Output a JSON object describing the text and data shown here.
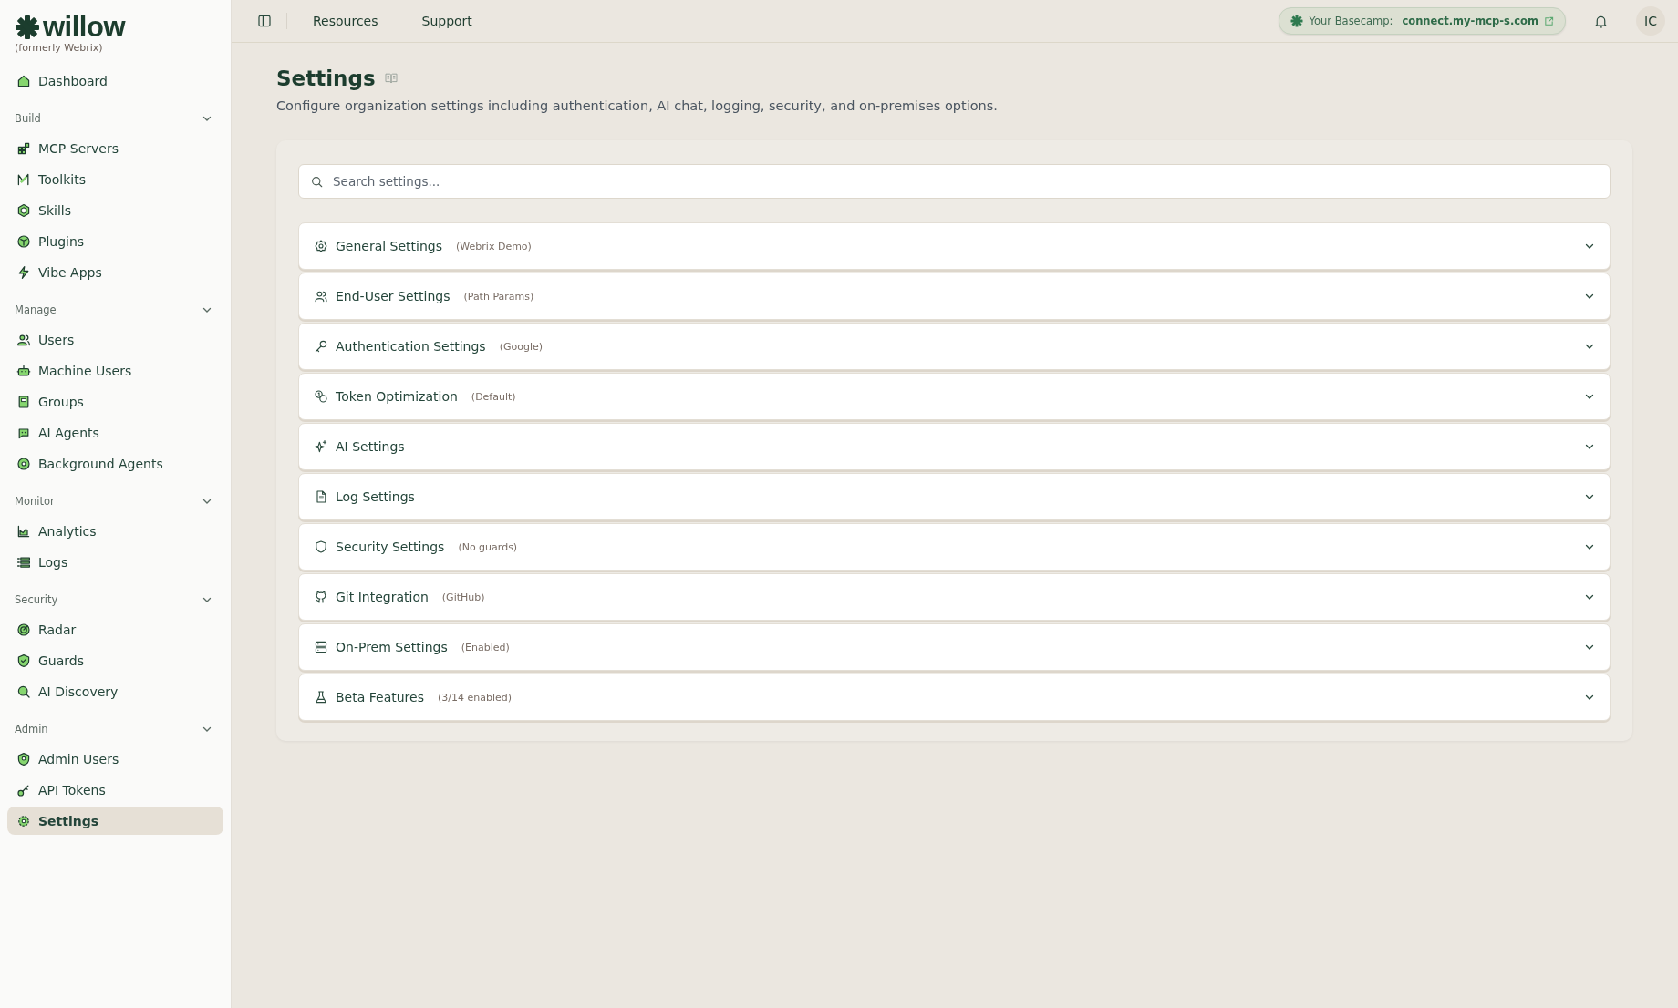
{
  "sidebar": {
    "logo": {
      "name": "willow",
      "subtitle": "(formerly Webrix)"
    },
    "top_items": [
      {
        "label": "Dashboard",
        "selected": false
      }
    ],
    "sections": [
      {
        "title": "Build",
        "expanded": true,
        "items": [
          {
            "label": "MCP Servers",
            "selected": false
          },
          {
            "label": "Toolkits",
            "selected": false
          },
          {
            "label": "Skills",
            "selected": false
          },
          {
            "label": "Plugins",
            "selected": false
          },
          {
            "label": "Vibe Apps",
            "selected": false
          }
        ]
      },
      {
        "title": "Manage",
        "expanded": true,
        "items": [
          {
            "label": "Users",
            "selected": false
          },
          {
            "label": "Machine Users",
            "selected": false
          },
          {
            "label": "Groups",
            "selected": false
          },
          {
            "label": "AI Agents",
            "selected": false
          },
          {
            "label": "Background Agents",
            "selected": false
          }
        ]
      },
      {
        "title": "Monitor",
        "expanded": true,
        "items": [
          {
            "label": "Analytics",
            "selected": false
          },
          {
            "label": "Logs",
            "selected": false
          }
        ]
      },
      {
        "title": "Security",
        "expanded": true,
        "items": [
          {
            "label": "Radar",
            "selected": false
          },
          {
            "label": "Guards",
            "selected": false
          },
          {
            "label": "AI Discovery",
            "selected": false
          }
        ]
      },
      {
        "title": "Admin",
        "expanded": true,
        "items": [
          {
            "label": "Admin Users",
            "selected": false
          },
          {
            "label": "API Tokens",
            "selected": false
          },
          {
            "label": "Settings",
            "selected": true
          }
        ]
      }
    ]
  },
  "top_bar": {
    "links": [
      "Resources",
      "Support"
    ],
    "basecamp": {
      "label": "Your Basecamp:",
      "link": "connect.my-mcp-s.com"
    },
    "avatar": "IC"
  },
  "page": {
    "title": "Settings",
    "description": "Configure organization settings including authentication, AI chat, logging, security, and on-premises options.",
    "search": {
      "placeholder": "Search settings..."
    },
    "settings": [
      {
        "title": "General Settings",
        "detail": "(Webrix Demo)",
        "expanded": false
      },
      {
        "title": "End-User Settings",
        "detail": "(Path Params)",
        "expanded": false
      },
      {
        "title": "Authentication Settings",
        "detail": "(Google)",
        "expanded": false
      },
      {
        "title": "Token Optimization",
        "detail": "(Default)",
        "expanded": false
      },
      {
        "title": "AI Settings",
        "expanded": false
      },
      {
        "title": "Log Settings",
        "expanded": false
      },
      {
        "title": "Security Settings",
        "detail": "(No guards)",
        "expanded": false
      },
      {
        "title": "Git Integration",
        "detail": "(GitHub)",
        "expanded": false
      },
      {
        "title": "On-Prem Settings",
        "detail": "(Enabled)",
        "expanded": false
      },
      {
        "title": "Beta Features",
        "detail": "(3/14 enabled)",
        "expanded": false
      }
    ]
  }
}
